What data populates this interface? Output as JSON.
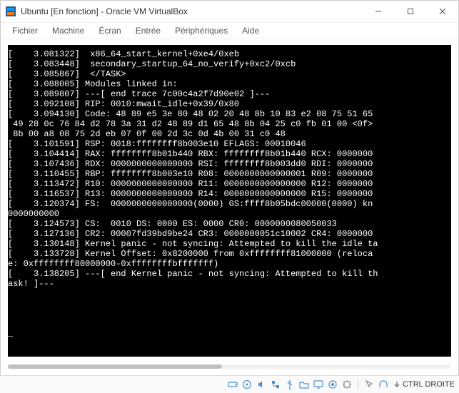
{
  "window": {
    "title": "Ubuntu [En fonction] - Oracle VM VirtualBox"
  },
  "menu": {
    "items": [
      "Fichier",
      "Machine",
      "Écran",
      "Entrée",
      "Périphériques",
      "Aide"
    ]
  },
  "console_lines": [
    "[    3.081322]  x86_64_start_kernel+0xe4/0xeb",
    "[    3.083448]  secondary_startup_64_no_verify+0xc2/0xcb",
    "[    3.085867]  </TASK>",
    "[    3.088005] Modules linked in:",
    "[    3.089807] ---[ end trace 7c00c4a2f7d90e02 ]---",
    "[    3.092108] RIP: 0010:mwait_idle+0x39/0x80",
    "[    3.094130] Code: 48 89 e5 3e 80 48 02 20 48 8b 10 83 e2 08 75 51 65",
    " 49 28 0c 76 84 d2 78 3a 31 d2 48 89 d1 65 48 8b 04 25 c0 fb 01 00 <0f>",
    " 8b 00 a8 08 75 2d eb 07 0f 00 2d 3c 0d 4b 00 31 c0 48",
    "[    3.101591] RSP: 0018:ffffffff8b003e10 EFLAGS: 00010046",
    "[    3.104414] RAX: ffffffff8b01b440 RBX: ffffffff8b01b440 RCX: 0000000",
    "[    3.107436] RDX: 0000000000000000 RSI: ffffffff8b003dd0 RDI: 0000000",
    "[    3.110455] RBP: ffffffff8b003e10 R08: 0000000000000001 R09: 0000000",
    "[    3.113472] R10: 0000000000000000 R11: 0000000000000000 R12: 0000000",
    "[    3.116537] R13: 0000000000000000 R14: 0000000000000000 R15: 0000000",
    "[    3.120374] FS:  0000000000000000(0000) GS:ffff8b05bdc00000(0000) kn",
    "0000000000                                                              ",
    "[    3.124573] CS:  0010 DS: 0000 ES: 0000 CR0: 0000000080050033",
    "[    3.127136] CR2: 00007fd39bd9be24 CR3: 0000000051c10002 CR4: 0000000",
    "[    3.130148] Kernel panic - not syncing: Attempted to kill the idle ta",
    "[    3.133728] Kernel Offset: 0x8200000 from 0xffffffff81000000 (reloca",
    "e: 0xffffffff80000000-0xffffffffbfffffff)",
    "[    3.138205] ---[ end Kernel panic - not syncing: Attempted to kill th",
    "ask! ]---",
    "",
    "",
    "",
    "",
    "_                                                                       "
  ],
  "status": {
    "host_key": "CTRL DROITE"
  }
}
